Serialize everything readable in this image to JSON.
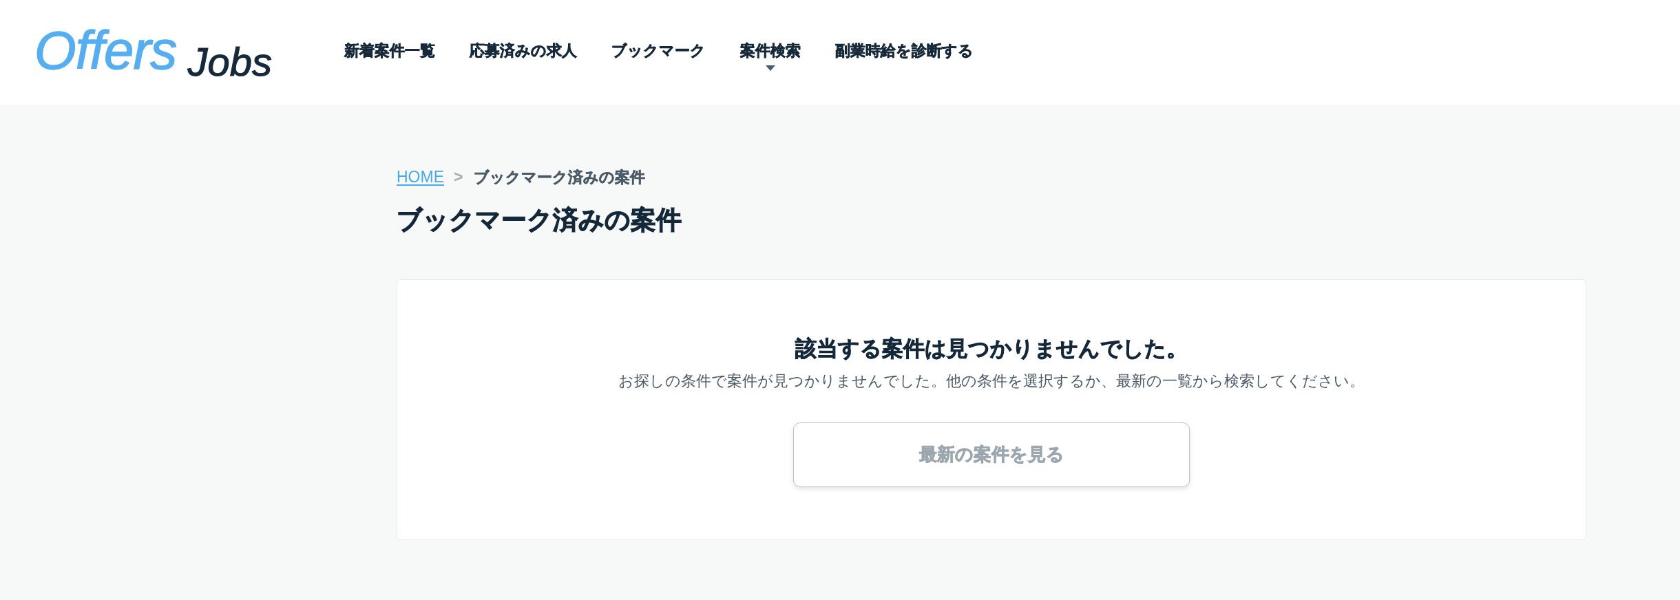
{
  "header": {
    "logo": {
      "primary": "Offers",
      "secondary": "Jobs"
    },
    "nav": [
      {
        "label": "新着案件一覧",
        "dropdown": false
      },
      {
        "label": "応募済みの求人",
        "dropdown": false
      },
      {
        "label": "ブックマーク",
        "dropdown": false
      },
      {
        "label": "案件検索",
        "dropdown": true
      },
      {
        "label": "副業時給を診断する",
        "dropdown": false
      }
    ]
  },
  "breadcrumb": {
    "separator": ">",
    "items": [
      {
        "label": "HOME",
        "kind": "link"
      },
      {
        "label": "ブックマーク済みの案件",
        "kind": "current"
      }
    ]
  },
  "page_title": "ブックマーク済みの案件",
  "empty_state": {
    "heading": "該当する案件は見つかりませんでした。",
    "message": "お探しの条件で案件が見つかりませんでした。他の条件を選択するか、最新の一覧から検索してください。",
    "button": "最新の案件を見る"
  }
}
